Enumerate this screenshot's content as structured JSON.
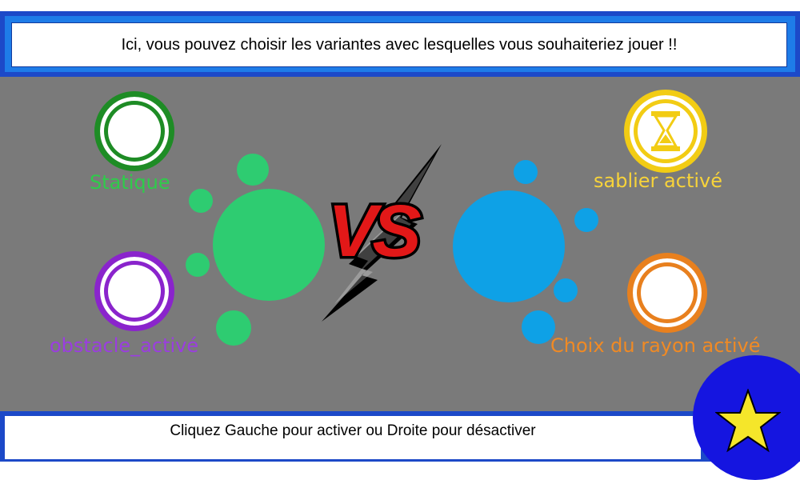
{
  "header": {
    "text": "Ici, vous pouvez choisir les variantes avec lesquelles vous souhaiteriez jouer !!"
  },
  "footer": {
    "text": "Cliquez Gauche pour activer ou Droite pour désactiver"
  },
  "variants": [
    {
      "label": "Statique",
      "color": "#2ecc4a",
      "ring_color": "#1e8c25"
    },
    {
      "label": "obstacle_activé",
      "color": "#9b3de0",
      "ring_color": "#8a24cc"
    },
    {
      "label": "sablier activé",
      "color": "#f7d33a",
      "ring_color": "#f2cc14"
    },
    {
      "label": "Choix du rayon activé",
      "color": "#f08a24",
      "ring_color": "#e8801e"
    }
  ],
  "players": {
    "left_color": "#2ecc71",
    "right_color": "#0ea1e6"
  },
  "vs": {
    "text": "VS"
  },
  "colors": {
    "frame_blue": "#1c49c8",
    "arena_gray": "#7a7a7a",
    "star": "#f5e62a"
  },
  "icons": {
    "star": "star-icon",
    "hourglass": "hourglass-icon"
  }
}
